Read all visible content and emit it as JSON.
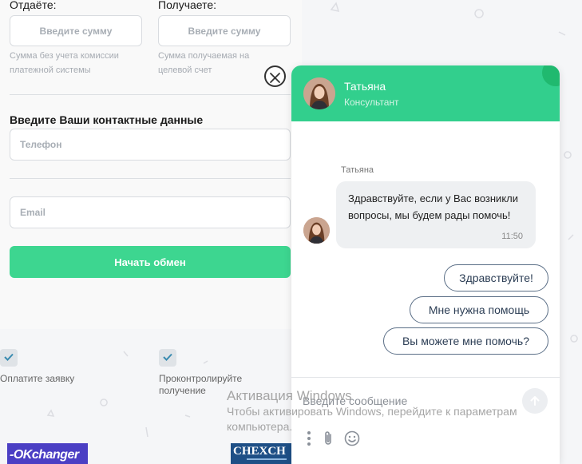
{
  "form": {
    "give_label": "Отдаёте:",
    "receive_label": "Получаете:",
    "amount_placeholder": "Введите сумму",
    "give_hint": "Сумма без учета комиссии платежной системы",
    "receive_hint": "Сумма получаемая на целевой счет",
    "contacts_title": "Введите Ваши контактные данные",
    "phone_placeholder": "Телефон",
    "email_placeholder": "Email",
    "start_button": "Начать обмен"
  },
  "steps": [
    {
      "label": "Оплатите заявку"
    },
    {
      "label": "Проконтролируйте получение"
    }
  ],
  "logos": {
    "okchanger": "-OKchanger",
    "chexchange": "CHEXCH"
  },
  "windows_activation": {
    "title": "Активация Windows",
    "text": "Чтобы активировать Windows, перейдите к параметрам компьютера."
  },
  "chat": {
    "agent_name": "Татьяна",
    "agent_role": "Консультант",
    "message": {
      "sender": "Татьяна",
      "text": "Здравствуйте, если у Вас возникли вопросы, мы будем рады помочь!",
      "time": "11:50"
    },
    "quick_replies": [
      "Здравствуйте!",
      "Мне нужна помощь",
      "Вы можете мне помочь?"
    ],
    "input_placeholder": "Введите сообщение"
  },
  "colors": {
    "accent": "#32cf8d",
    "button": "#3dd690",
    "quick_border": "#5a6e86"
  }
}
